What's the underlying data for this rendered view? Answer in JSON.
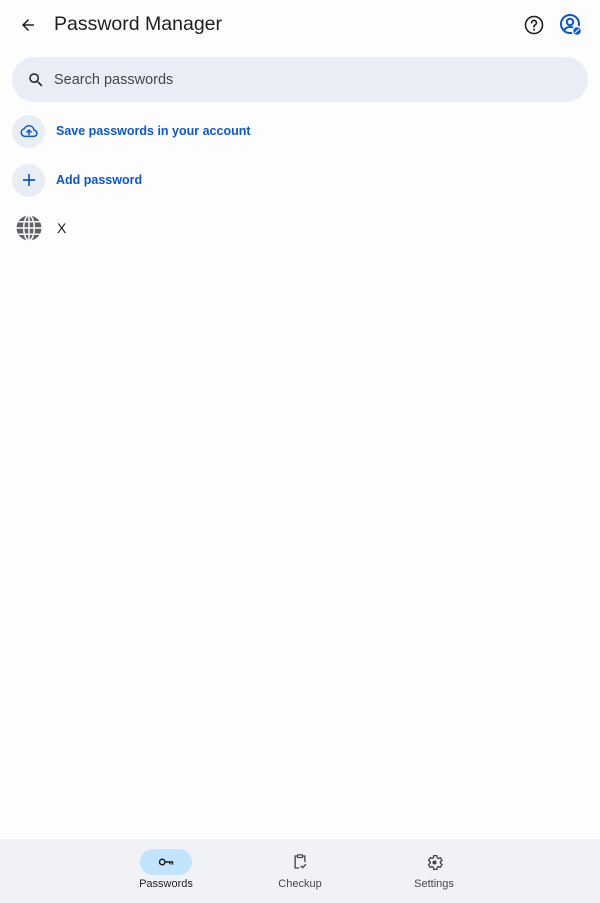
{
  "header": {
    "title": "Password Manager",
    "back_icon": "arrow-back-icon",
    "help_icon": "help-circle-icon",
    "account_icon": "account-circle-icon"
  },
  "search": {
    "placeholder": "Search passwords",
    "value": "",
    "icon": "search-icon"
  },
  "actions": [
    {
      "label": "Save passwords in your account",
      "icon": "cloud-upload-icon"
    },
    {
      "label": "Add password",
      "icon": "plus-icon"
    }
  ],
  "passwords": [
    {
      "site": "X",
      "icon": "globe-icon"
    }
  ],
  "bottom_nav": {
    "items": [
      {
        "label": "Passwords",
        "icon": "key-icon",
        "active": true
      },
      {
        "label": "Checkup",
        "icon": "clipboard-check-icon",
        "active": false
      },
      {
        "label": "Settings",
        "icon": "gear-icon",
        "active": false
      }
    ]
  },
  "colors": {
    "accent": "#0b57d0",
    "search_bg": "#e9edf5",
    "nav_active_bg": "#c2e4ff",
    "nav_bg": "#f0f2f6"
  }
}
